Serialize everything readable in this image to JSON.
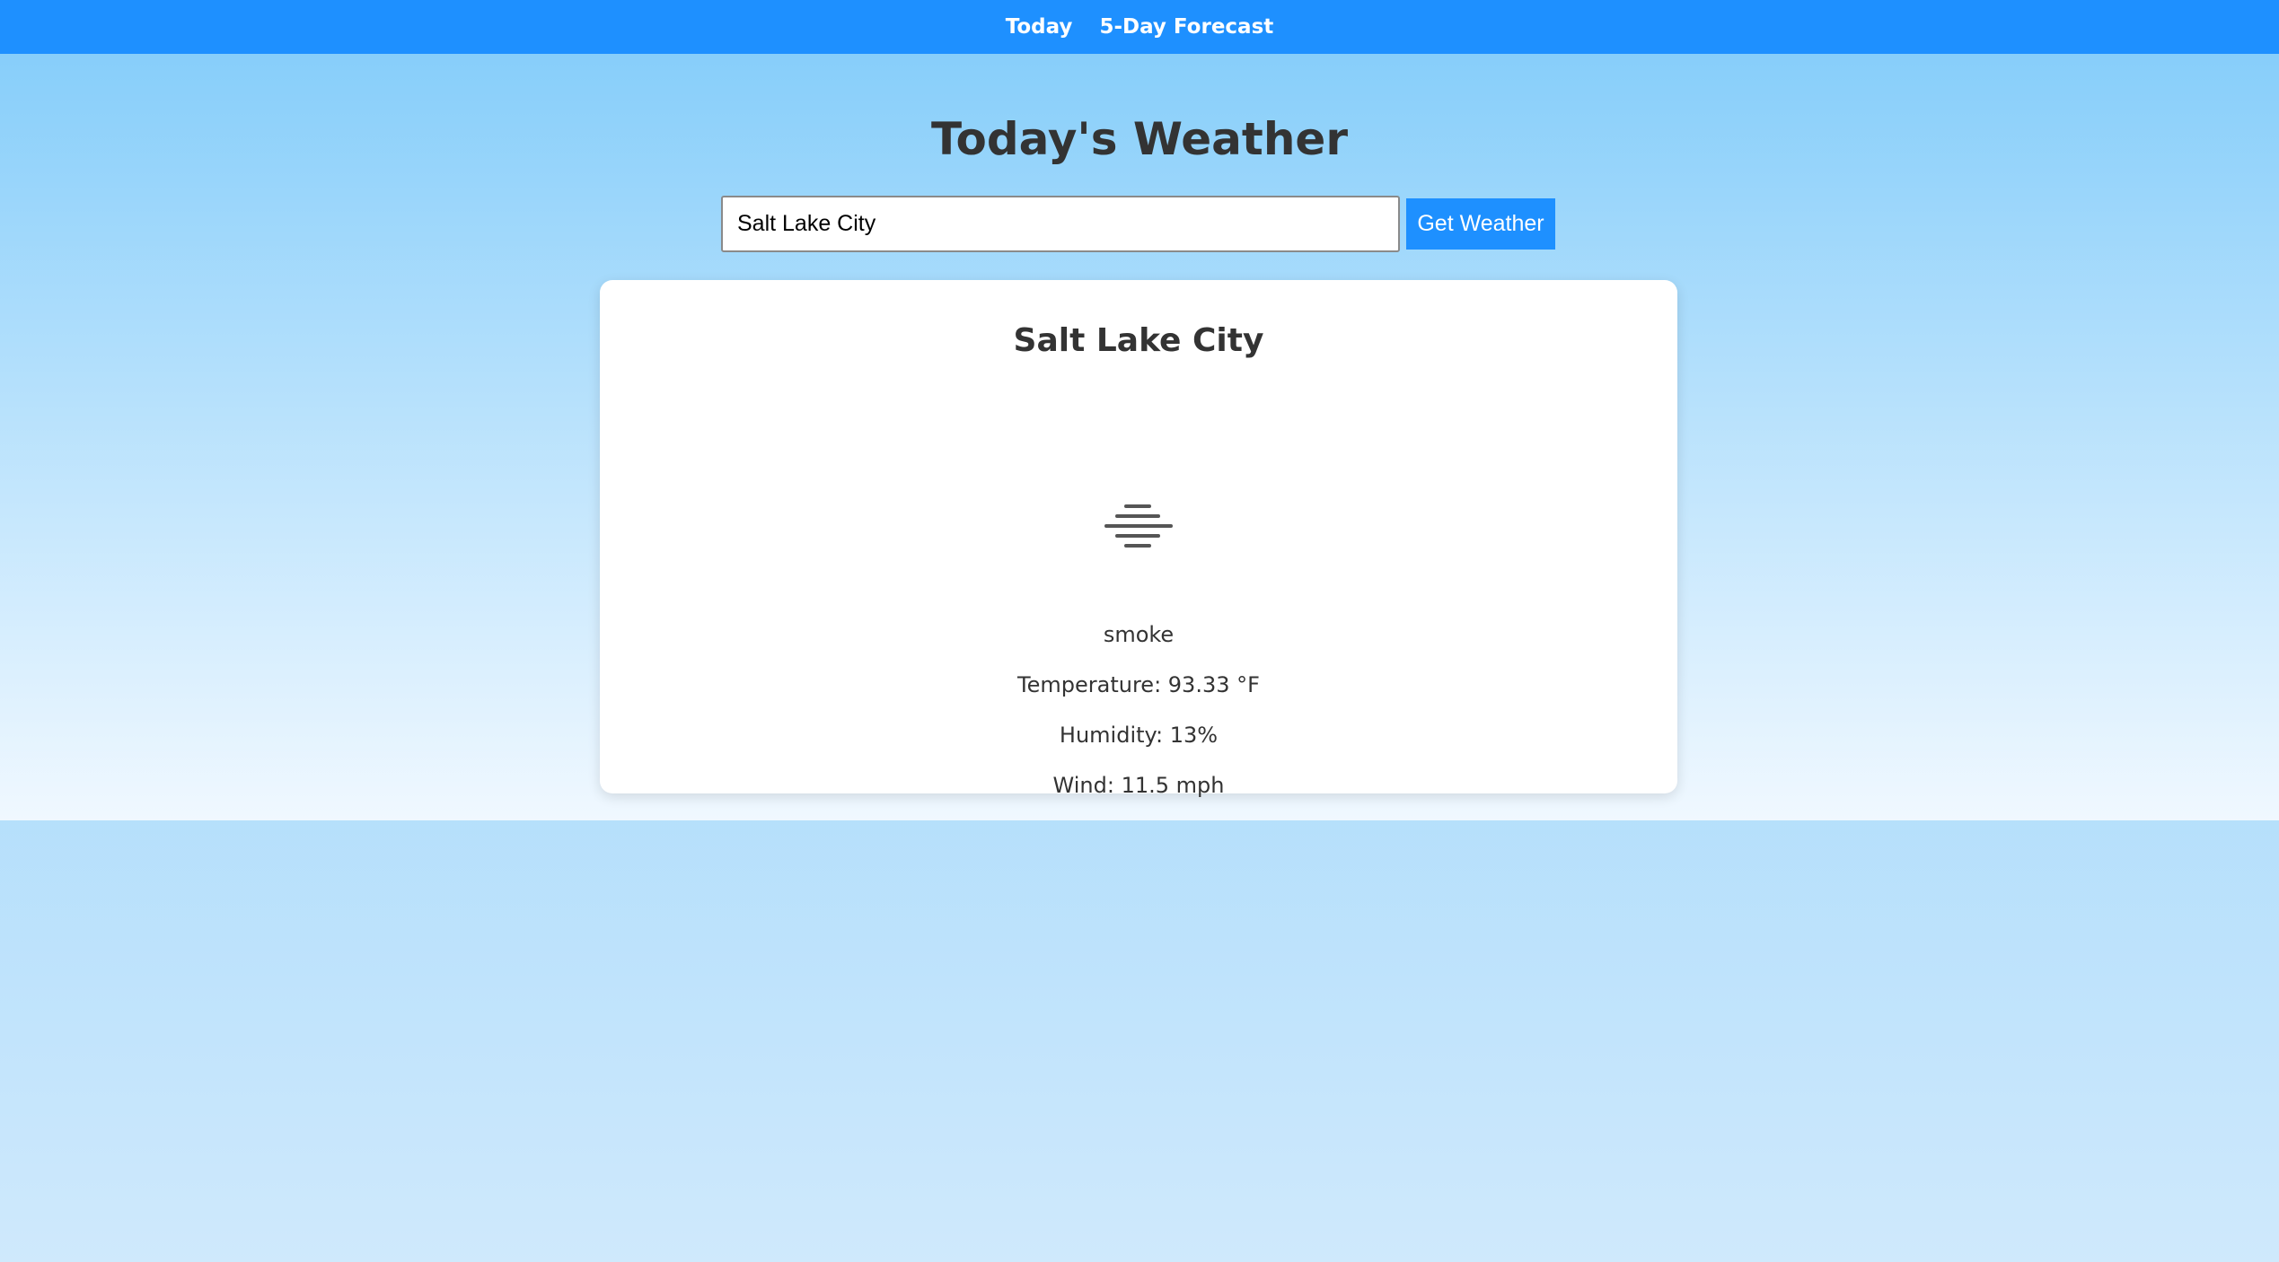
{
  "nav": {
    "today": "Today",
    "forecast": "5-Day Forecast"
  },
  "page": {
    "title": "Today's Weather"
  },
  "search": {
    "value": "Salt Lake City",
    "button_label": "Get Weather"
  },
  "weather": {
    "city": "Salt Lake City",
    "icon": "smoke-icon",
    "description": "smoke",
    "temperature": "Temperature: 93.33 °F",
    "humidity": "Humidity: 13%",
    "wind": "Wind: 11.5 mph"
  },
  "colors": {
    "nav_bg": "#1e90ff",
    "button_bg": "#1e90ff",
    "text": "#333333"
  }
}
